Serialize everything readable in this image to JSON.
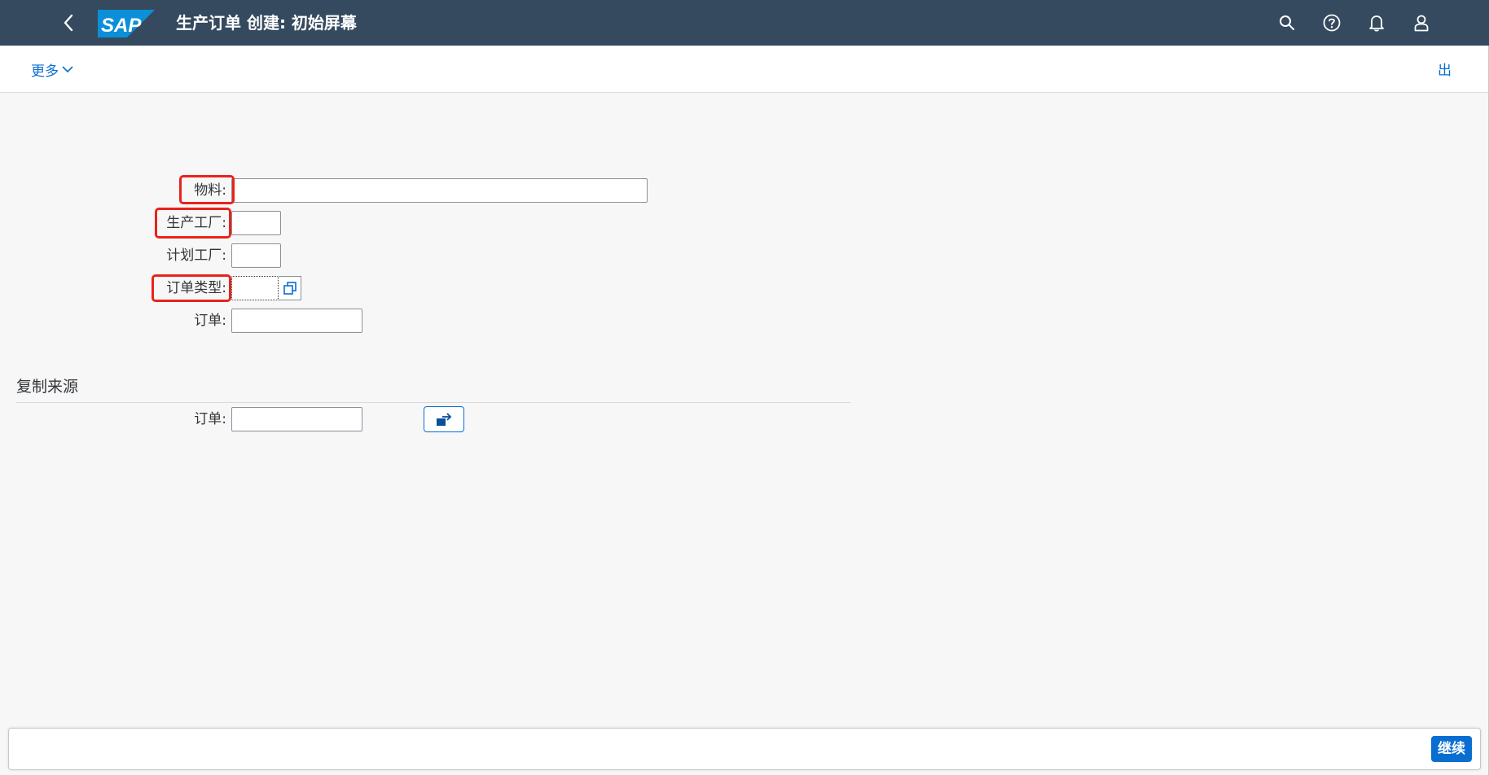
{
  "shell": {
    "title": "生产订单 创建: 初始屏幕",
    "logo_text": "SAP",
    "icons": [
      "back-icon",
      "search-icon",
      "help-icon",
      "bell-icon",
      "user-icon"
    ],
    "colors": {
      "bar": "#354a5f",
      "logo": "#0a8fd8",
      "accent": "#0a6ed1",
      "highlight": "#e8231c"
    }
  },
  "toolbar": {
    "more_label": "更多",
    "exit_label": "出"
  },
  "form": {
    "material_label": "物料:",
    "material_value": "",
    "production_plant_label": "生产工厂:",
    "production_plant_value": "",
    "planning_plant_label": "计划工厂:",
    "planning_plant_value": "",
    "order_type_label": "订单类型:",
    "order_type_value": "",
    "order_label": "订单:",
    "order_value": ""
  },
  "copy_from": {
    "title": "复制来源",
    "order_label": "订单:",
    "order_value": ""
  },
  "footer": {
    "continue_label": "继续"
  }
}
